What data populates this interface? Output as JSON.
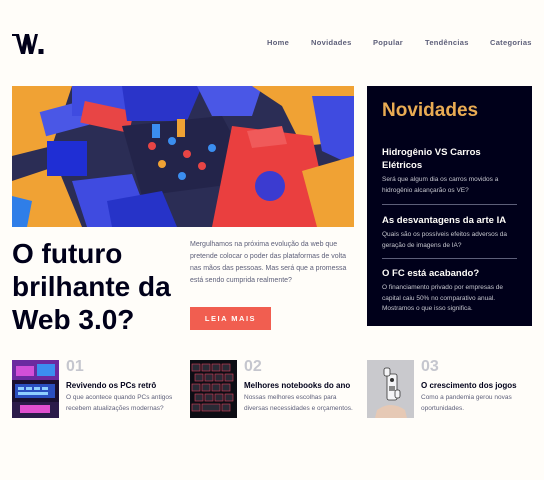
{
  "brand": {
    "logo_text": "W."
  },
  "nav": {
    "items": [
      {
        "label": "Home"
      },
      {
        "label": "Novidades"
      },
      {
        "label": "Popular"
      },
      {
        "label": "Tendências"
      },
      {
        "label": "Categorias"
      }
    ]
  },
  "hero": {
    "headline": "O futuro brilhante da Web 3.0?",
    "description": "Mergulhamos na próxima evolução da web que pretende colocar o poder das plataformas de volta nas mãos das pessoas. Mas será que a promessa está sendo cumprida realmente?",
    "button_label": "LEIA MAIS"
  },
  "news": {
    "title": "Novidades",
    "items": [
      {
        "title": "Hidrogênio VS Carros Elétricos",
        "description": "Será que algum dia os carros movidos a hidrogênio alcançarão os VE?"
      },
      {
        "title": "As desvantagens da arte IA",
        "description": "Quais são os possíveis efeitos adversos da geração de imagens de IA?"
      },
      {
        "title": "O FC está acabando?",
        "description": "O financiamento privado por empresas de capital caiu 50% no comparativo anual. Mostramos o que isso significa."
      }
    ]
  },
  "cards": [
    {
      "number": "01",
      "title": "Revivendo os PCs retrô",
      "description": "O que acontece quando PCs antigos recebem atualizações modernas?"
    },
    {
      "number": "02",
      "title": "Melhores notebooks do ano",
      "description": "Nossas melhores escolhas para diversas necessidades e orçamentos."
    },
    {
      "number": "03",
      "title": "O crescimento dos jogos",
      "description": "Como a pandemia gerou novas oportunidades."
    }
  ],
  "colors": {
    "background": "#fffdf9",
    "dark": "#00001a",
    "accent_red": "#f15e50",
    "accent_gold": "#e9ab53",
    "muted": "#5d5f79",
    "light_gray": "#c5c6ce"
  }
}
